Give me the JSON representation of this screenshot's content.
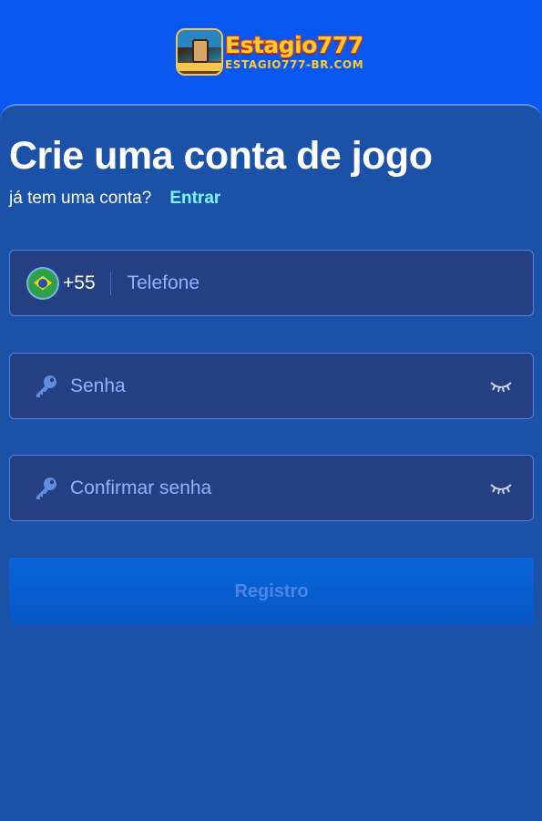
{
  "header": {
    "logo_title": "Estagio777",
    "logo_subtitle": "ESTAGIO777-BR.COM"
  },
  "form": {
    "title": "Crie uma conta de jogo",
    "have_account_text": "já tem uma conta?",
    "login_link": "Entrar",
    "phone": {
      "country_code": "+55",
      "placeholder": "Telefone",
      "value": ""
    },
    "password": {
      "placeholder": "Senha",
      "value": ""
    },
    "confirm_password": {
      "placeholder": "Confirmar senha",
      "value": ""
    },
    "submit_label": "Registro"
  },
  "icons": {
    "flag": "brazil-flag-icon",
    "key": "key-icon",
    "eye": "eye-closed-icon"
  },
  "colors": {
    "background": "#0857f0",
    "panel": "#1b52a8",
    "field": "#243f82",
    "link": "#7df5ff",
    "button": "#0a66d9"
  }
}
